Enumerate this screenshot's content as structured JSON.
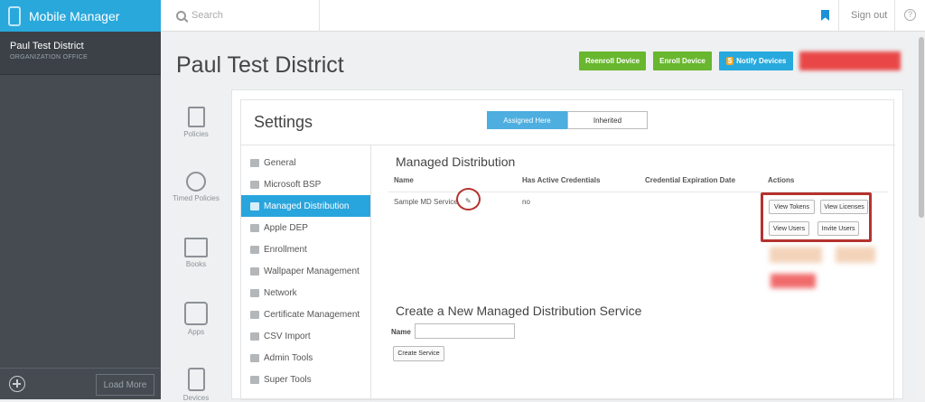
{
  "app": {
    "title": "Mobile Manager"
  },
  "search": {
    "placeholder": "Search"
  },
  "header": {
    "signout": "Sign out",
    "help": "?"
  },
  "org": {
    "name": "Paul Test District",
    "subtitle": "ORGANIZATION OFFICE"
  },
  "sidebar_footer": {
    "load_more": "Load More"
  },
  "page": {
    "title": "Paul Test District"
  },
  "actions": {
    "reenroll": "Reenroll Device",
    "enroll": "Enroll Device",
    "notify": "Notify Devices",
    "notify_symbol": "$"
  },
  "left_nav": [
    {
      "label": "Policies"
    },
    {
      "label": "Timed Policies"
    },
    {
      "label": "Books"
    },
    {
      "label": "Apps"
    },
    {
      "label": "Devices"
    }
  ],
  "settings": {
    "title": "Settings",
    "tabs": {
      "assigned": "Assigned Here",
      "inherited": "Inherited"
    },
    "nav": [
      "General",
      "Microsoft BSP",
      "Managed Distribution",
      "Apple DEP",
      "Enrollment",
      "Wallpaper Management",
      "Network",
      "Certificate Management",
      "CSV Import",
      "Admin Tools",
      "Super Tools"
    ]
  },
  "managed_distribution": {
    "title": "Managed Distribution",
    "columns": [
      "Name",
      "Has Active Credentials",
      "Credential Expiration Date",
      "Actions"
    ],
    "row": {
      "name": "Sample MD Service",
      "has_active": "no",
      "expiration": ""
    },
    "buttons": {
      "view_tokens": "View Tokens",
      "view_licenses": "View Licenses",
      "view_users": "View Users",
      "invite_users": "Invite Users"
    }
  },
  "create_service": {
    "title": "Create a New Managed Distribution Service",
    "name_label": "Name",
    "name_value": "",
    "button": "Create Service"
  },
  "colors": {
    "accent": "#29a8dc",
    "green": "#68b72e",
    "danger": "#b5322e"
  }
}
